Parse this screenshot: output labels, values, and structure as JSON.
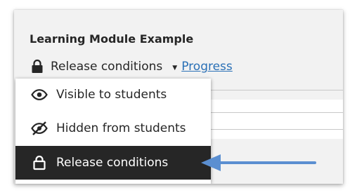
{
  "module": {
    "title": "Learning Module Example"
  },
  "status": {
    "icon": "lock-icon",
    "label": "Release conditions",
    "dropdown_icon": "caret-down-icon",
    "progress_link": "Progress"
  },
  "menu": {
    "items": [
      {
        "label": "Visible to students",
        "icon": "eye-icon",
        "selected": false
      },
      {
        "label": "Hidden from students",
        "icon": "eye-slash-icon",
        "selected": false
      },
      {
        "label": "Release conditions",
        "icon": "lock-icon",
        "selected": true
      }
    ]
  },
  "annotation": {
    "icon": "arrow-left-icon"
  },
  "colors": {
    "selected_bg": "#262626",
    "link": "#2a70b6",
    "arrow": "#5b8fd1",
    "panel_bg": "#f2f2f2"
  }
}
